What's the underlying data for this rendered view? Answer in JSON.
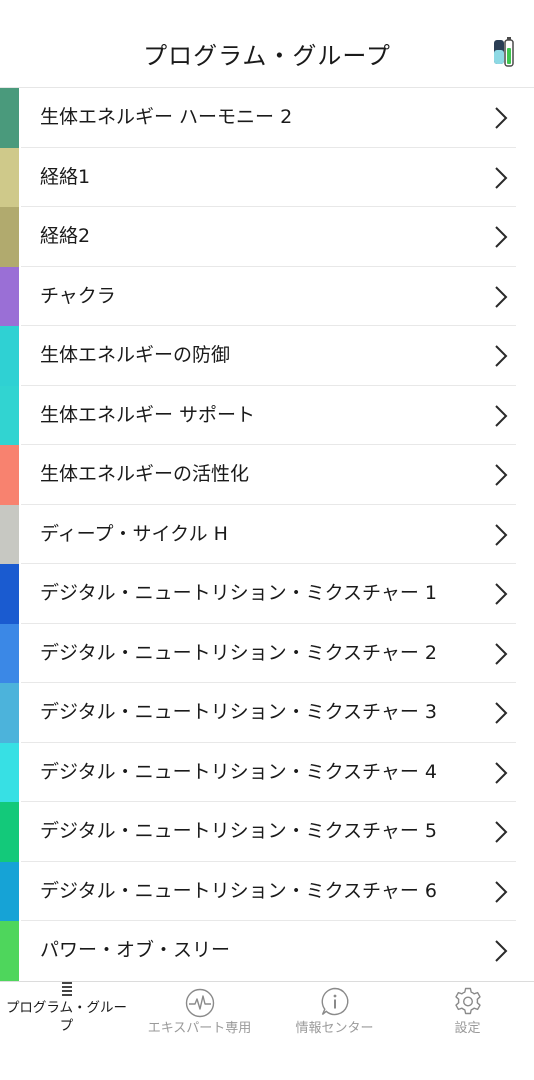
{
  "header": {
    "title": "プログラム・グループ"
  },
  "status": {
    "battery_icon": "battery-icon"
  },
  "groups": [
    {
      "label": "生体エネルギー ハーモニー 2",
      "color": "#4a9a7c"
    },
    {
      "label": "経絡1",
      "color": "#cfc98a"
    },
    {
      "label": "経絡2",
      "color": "#b1aa6e"
    },
    {
      "label": "チャクラ",
      "color": "#9a6fd6"
    },
    {
      "label": "生体エネルギーの防御",
      "color": "#2fd1d3"
    },
    {
      "label": "生体エネルギー サポート",
      "color": "#31d4d1"
    },
    {
      "label": "生体エネルギーの活性化",
      "color": "#f8826f"
    },
    {
      "label": "ディープ・サイクル H",
      "color": "#c7c8c2"
    },
    {
      "label": "デジタル・ニュートリション・ミクスチャー 1",
      "color": "#1a5bd0"
    },
    {
      "label": "デジタル・ニュートリション・ミクスチャー 2",
      "color": "#3b88e6"
    },
    {
      "label": "デジタル・ニュートリション・ミクスチャー 3",
      "color": "#4cb3db"
    },
    {
      "label": "デジタル・ニュートリション・ミクスチャー 4",
      "color": "#37e0e4"
    },
    {
      "label": "デジタル・ニュートリション・ミクスチャー 5",
      "color": "#13c97a"
    },
    {
      "label": "デジタル・ニュートリション・ミクスチャー 6",
      "color": "#16a3d6"
    },
    {
      "label": "パワー・オブ・スリー",
      "color": "#4ed65c"
    }
  ],
  "tabs": [
    {
      "label": "プログラム・グループ",
      "icon": "list-icon",
      "active": true
    },
    {
      "label": "エキスパート専用",
      "icon": "pulse-icon",
      "active": false
    },
    {
      "label": "情報センター",
      "icon": "info-icon",
      "active": false
    },
    {
      "label": "設定",
      "icon": "gear-icon",
      "active": false
    }
  ]
}
